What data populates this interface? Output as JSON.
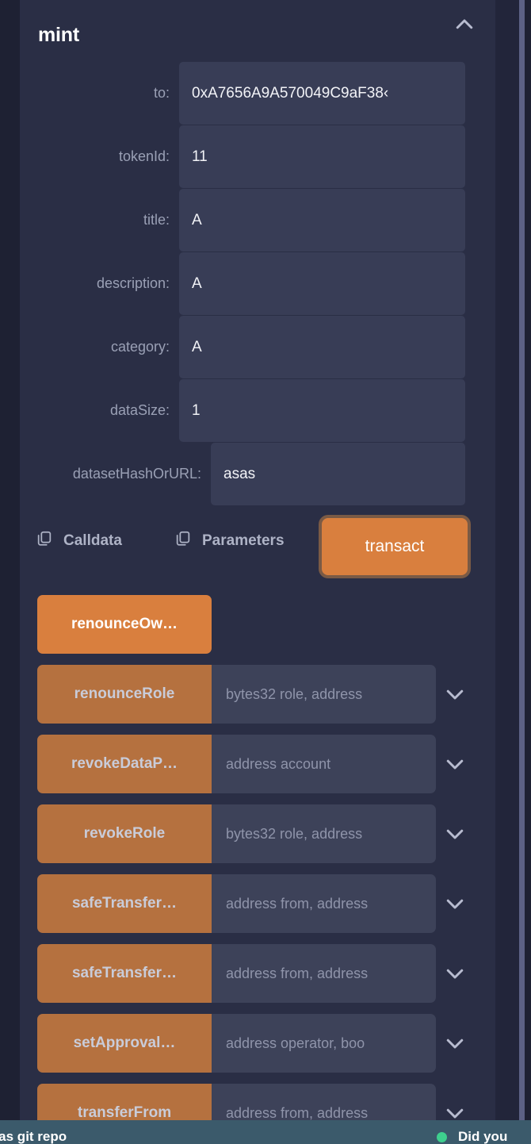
{
  "panel": {
    "function_name": "mint",
    "collapse_icon": "chevron-up-icon"
  },
  "form": {
    "fields": [
      {
        "label": "to:",
        "value": "0xA7656A9A570049C9aF38‹",
        "wide": false
      },
      {
        "label": "tokenId:",
        "value": "11",
        "wide": false
      },
      {
        "label": "title:",
        "value": "A",
        "wide": false
      },
      {
        "label": "description:",
        "value": "A",
        "wide": false
      },
      {
        "label": "category:",
        "value": "A",
        "wide": false
      },
      {
        "label": "dataSize:",
        "value": "1",
        "wide": false
      },
      {
        "label": "datasetHashOrURL:",
        "value": "asas",
        "wide": true
      }
    ]
  },
  "actions": {
    "calldata_label": "Calldata",
    "calldata_icon": "copy-icon",
    "parameters_label": "Parameters",
    "parameters_icon": "copy-icon",
    "transact_label": "transact"
  },
  "functions": [
    {
      "name": "renounceOw…",
      "signature": "",
      "standalone": true,
      "expand_icon": ""
    },
    {
      "name": "renounceRole",
      "signature": "bytes32 role, address",
      "standalone": false,
      "expand_icon": "chevron-down-icon"
    },
    {
      "name": "revokeDataP…",
      "signature": "address account",
      "standalone": false,
      "expand_icon": "chevron-down-icon"
    },
    {
      "name": "revokeRole",
      "signature": "bytes32 role, address",
      "standalone": false,
      "expand_icon": "chevron-down-icon"
    },
    {
      "name": "safeTransfer…",
      "signature": "address from, address",
      "standalone": false,
      "expand_icon": "chevron-down-icon"
    },
    {
      "name": "safeTransfer…",
      "signature": "address from, address",
      "standalone": false,
      "expand_icon": "chevron-down-icon"
    },
    {
      "name": "setApproval…",
      "signature": "address operator, boo",
      "standalone": false,
      "expand_icon": "chevron-down-icon"
    },
    {
      "name": "transferFrom",
      "signature": "address from, address",
      "standalone": false,
      "expand_icon": "chevron-down-icon"
    }
  ],
  "status_bar": {
    "left_text": "e as git repo",
    "right_text": "Did you",
    "indicator_color": "#3ecf8e"
  },
  "colors": {
    "accent_orange": "#d97f3e",
    "muted_orange": "#b5713f",
    "panel_bg": "#2a2e45",
    "input_bg": "#383d56",
    "status_bg": "#3b5a6b"
  }
}
